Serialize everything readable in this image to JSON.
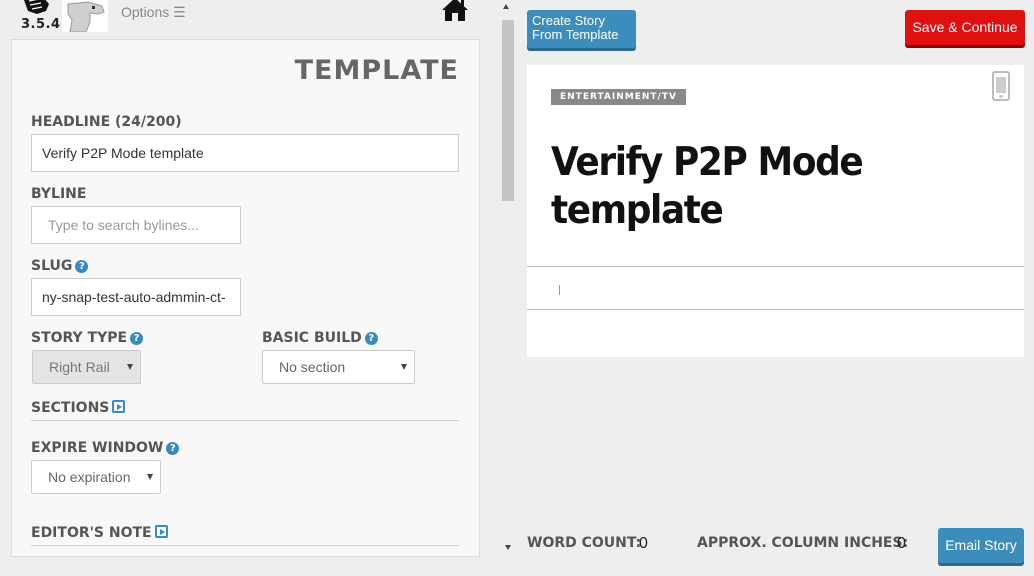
{
  "header": {
    "version": "3.5.4",
    "options_label": "Options ☰"
  },
  "form": {
    "title": "TEMPLATE",
    "headline_label": "HEADLINE (24/200)",
    "headline_value": "Verify P2P Mode template",
    "byline_label": "BYLINE",
    "byline_placeholder": "Type to search bylines...",
    "slug_label": "SLUG",
    "slug_value": "ny-snap-test-auto-admmin-ct-",
    "story_type_label": "STORY TYPE",
    "story_type_value": "Right Rail",
    "basic_build_label": "BASIC BUILD",
    "basic_build_value": "No section",
    "sections_label": "SECTIONS",
    "expire_window_label": "EXPIRE WINDOW",
    "expire_window_value": "No expiration",
    "editors_note_label": "EDITOR'S NOTE"
  },
  "toolbar": {
    "create_template_label": "Create Story From Template",
    "save_label": "Save & Continue",
    "email_label": "Email Story"
  },
  "preview": {
    "category": "ENTERTAINMENT/TV",
    "headline": "Verify P2P Mode template"
  },
  "footer": {
    "word_count_label": "WORD COUNT:",
    "word_count_value": "0",
    "column_inches_label": "APPROX. COLUMN INCHES:",
    "column_inches_value": "0"
  },
  "colors": {
    "accent_blue": "#3c8dbc",
    "save_red": "#e01010",
    "badge_gray": "#888888"
  },
  "icons": [
    "fist-logo-icon",
    "dinosaur-avatar",
    "menu-icon",
    "home-icon",
    "help-icon",
    "play-icon",
    "caret-down-icon",
    "mobile-phone-icon"
  ]
}
